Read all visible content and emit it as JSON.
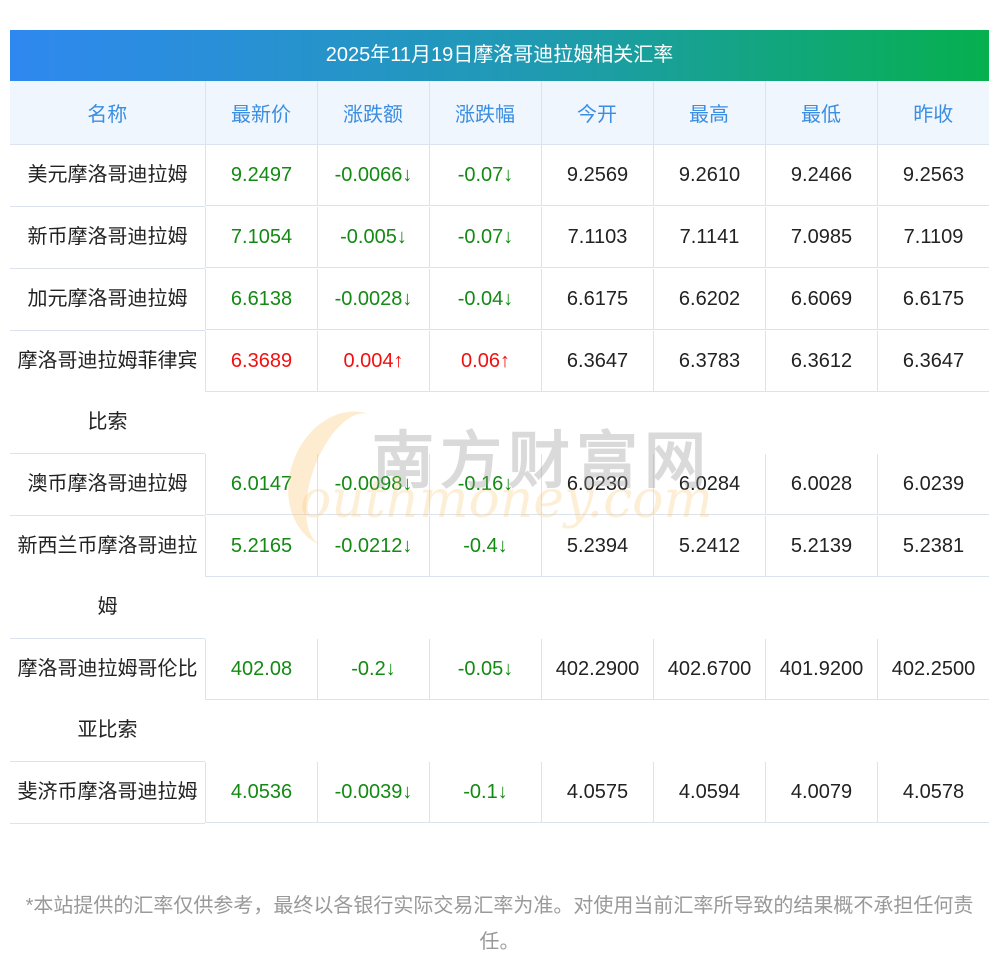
{
  "title": "2025年11月19日摩洛哥迪拉姆相关汇率",
  "headers": [
    "名称",
    "最新价",
    "涨跌额",
    "涨跌幅",
    "今开",
    "最高",
    "最低",
    "昨收"
  ],
  "rows": [
    {
      "name": "美元摩洛哥迪拉姆",
      "price": "9.2497",
      "change": "-0.0066↓",
      "pct": "-0.07↓",
      "open": "9.2569",
      "high": "9.2610",
      "low": "9.2466",
      "prev": "9.2563",
      "dir": "down"
    },
    {
      "name": "新币摩洛哥迪拉姆",
      "price": "7.1054",
      "change": "-0.005↓",
      "pct": "-0.07↓",
      "open": "7.1103",
      "high": "7.1141",
      "low": "7.0985",
      "prev": "7.1109",
      "dir": "down"
    },
    {
      "name": "加元摩洛哥迪拉姆",
      "price": "6.6138",
      "change": "-0.0028↓",
      "pct": "-0.04↓",
      "open": "6.6175",
      "high": "6.6202",
      "low": "6.6069",
      "prev": "6.6175",
      "dir": "down"
    },
    {
      "name": "摩洛哥迪拉姆菲律宾比索",
      "price": "6.3689",
      "change": "0.004↑",
      "pct": "0.06↑",
      "open": "6.3647",
      "high": "6.3783",
      "low": "6.3612",
      "prev": "6.3647",
      "dir": "up"
    },
    {
      "name": "澳币摩洛哥迪拉姆",
      "price": "6.0147",
      "change": "-0.0098↓",
      "pct": "-0.16↓",
      "open": "6.0230",
      "high": "6.0284",
      "low": "6.0028",
      "prev": "6.0239",
      "dir": "down"
    },
    {
      "name": "新西兰币摩洛哥迪拉姆",
      "price": "5.2165",
      "change": "-0.0212↓",
      "pct": "-0.4↓",
      "open": "5.2394",
      "high": "5.2412",
      "low": "5.2139",
      "prev": "5.2381",
      "dir": "down"
    },
    {
      "name": "摩洛哥迪拉姆哥伦比亚比索",
      "price": "402.08",
      "change": "-0.2↓",
      "pct": "-0.05↓",
      "open": "402.2900",
      "high": "402.6700",
      "low": "401.9200",
      "prev": "402.2500",
      "dir": "down"
    },
    {
      "name": "斐济币摩洛哥迪拉姆",
      "price": "4.0536",
      "change": "-0.0039↓",
      "pct": "-0.1↓",
      "open": "4.0575",
      "high": "4.0594",
      "low": "4.0079",
      "prev": "4.0578",
      "dir": "down"
    }
  ],
  "note": "*本站提供的汇率仅供参考，最终以各银行实际交易汇率为准。对使用当前汇率所导致的结果概不承担任何责任。",
  "watermark": {
    "cn": "南方财富网",
    "en": "outhmoney.com"
  },
  "colors": {
    "up": "#f01010",
    "down": "#138a13",
    "header_text": "#3b8ee0"
  }
}
